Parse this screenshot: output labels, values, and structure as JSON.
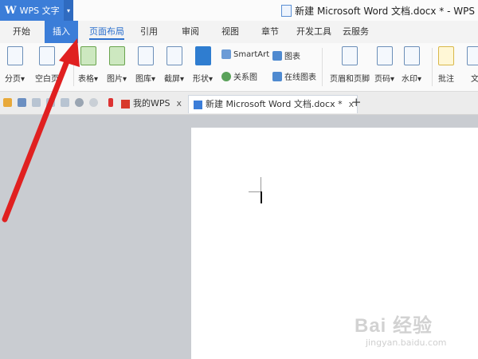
{
  "app": {
    "logo_text": "W",
    "name": "WPS 文字",
    "dropdown": "▾",
    "document_title": "新建 Microsoft Word 文档.docx * - WPS"
  },
  "menu_tabs": [
    "开始",
    "插入",
    "页面布局",
    "引用",
    "审阅",
    "视图",
    "章节",
    "开发工具",
    "云服务"
  ],
  "ribbon": {
    "break_page": "分页",
    "blank_page": "空白页",
    "table": "表格",
    "picture": "图片",
    "gallery": "图库",
    "screenshot": "截屏",
    "shape": "形状",
    "smartart": "SmartArt",
    "chart": "图表",
    "relation_chart": "关系图",
    "online_chart": "在线图表",
    "header_footer": "页眉和页脚",
    "page_number": "页码",
    "watermark_btn": "水印",
    "comment": "批注",
    "more": "文",
    "dropdown_glyph": "▾"
  },
  "doc_tabs": {
    "my_wps": "我的WPS",
    "current": "新建 Microsoft Word 文档.docx *",
    "close_glyph": "x",
    "new_tab": "+"
  },
  "watermark": {
    "main": "Bai 经验",
    "sub": "jingyan.baidu.com"
  },
  "colors": {
    "accent": "#3b7dd8",
    "arrow": "#e02020",
    "workspace": "#c9ccd1"
  }
}
